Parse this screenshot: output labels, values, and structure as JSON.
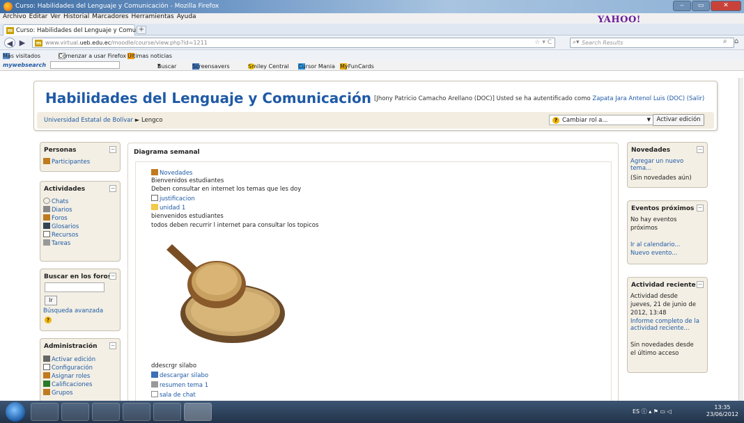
{
  "window": {
    "title": "Curso: Habilidades del Lenguaje y Comunicación - Mozilla Firefox"
  },
  "menu": [
    "Archivo",
    "Editar",
    "Ver",
    "Historial",
    "Marcadores",
    "Herramientas",
    "Ayuda"
  ],
  "yahoo_logo": "YAHOO!",
  "tab": {
    "label": "Curso: Habilidades del Lenguaje y Comu...",
    "new_tab": "+"
  },
  "nav": {
    "url_prefix": "www.virtual.",
    "url_domain": "ueb.edu.ec",
    "url_rest": "/moodle/course/view.php?id=1211",
    "search_placeholder": "Search Results"
  },
  "bookmarks": {
    "mas_visitados": "Más visitados",
    "comenzar": "Comenzar a usar Firefox",
    "ultimas": "Últimas noticias"
  },
  "mywebsearch": {
    "brand": "mywebsearch",
    "buscar": "Buscar",
    "screensavers": "Screensavers",
    "smiley": "Smiley Central",
    "cursor": "Cursor Mania",
    "myfun": "MyFunCards"
  },
  "header": {
    "title": "Habilidades del Lenguaje y Comunicación",
    "login_prefix": "[Jhony Patricio Camacho Arellano (DOC)] Usted se ha autentificado como",
    "login_user": "Zapata Jara Antenol Luis (DOC)",
    "login_logout": "(Salir)",
    "crumb_site": "Universidad Estatal de Bolívar",
    "crumb_sep": "►",
    "crumb_course": "Lengco",
    "role_label": "Cambiar rol a...",
    "edit_button": "Activar edición"
  },
  "blocks": {
    "personas": {
      "title": "Personas",
      "items": [
        "Participantes"
      ]
    },
    "actividades": {
      "title": "Actividades",
      "items": [
        "Chats",
        "Diarios",
        "Foros",
        "Glosarios",
        "Recursos",
        "Tareas"
      ]
    },
    "buscar": {
      "title": "Buscar en los foros",
      "button": "Ir",
      "advanced": "Búsqueda avanzada"
    },
    "admin": {
      "title": "Administración",
      "items": [
        "Activar edición",
        "Configuración",
        "Asignar roles",
        "Calificaciones",
        "Grupos"
      ]
    },
    "novedades": {
      "title": "Novedades",
      "add": "Agregar un nuevo",
      "add2": "tema...",
      "none": "(Sin novedades aún)"
    },
    "eventos": {
      "title": "Eventos próximos",
      "none1": "No hay eventos",
      "none2": "próximos",
      "calendar": "Ir al calendario...",
      "new": "Nuevo evento..."
    },
    "reciente": {
      "title": "Actividad reciente",
      "since1": "Actividad desde",
      "since2": "jueves, 21 de junio de",
      "since3": "2012, 13:48",
      "report1": "Informe completo de la",
      "report2": "actividad reciente...",
      "none1": "Sin novedades desde",
      "none2": "el último acceso"
    }
  },
  "main": {
    "title": "Diagrama semanal",
    "novedades": "Novedades",
    "line1": "Bienvenidos estudiantes",
    "line2": "Deben consultar en internet los temas que les doy",
    "justificacion": "justificacion",
    "unidad": "unidad 1",
    "line3": "bienvenidos estudiantes",
    "line4": "todos deben recurrir l internet para consultar los topicos",
    "line5": "ddescrgr silabo",
    "descargar": "descargar silabo",
    "resumen": "resumen tema 1",
    "sala": "sala de chat"
  },
  "taskbar": {
    "lang": "ES",
    "time": "13:35",
    "date": "23/06/2012"
  }
}
